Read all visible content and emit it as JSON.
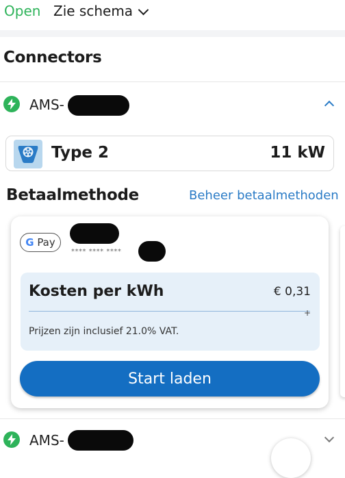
{
  "header": {
    "status": "Open",
    "schedule_link": "Zie schema"
  },
  "connectors_section": {
    "title": "Connectors"
  },
  "connectors": [
    {
      "name": "AMS-",
      "expanded": true
    },
    {
      "name": "AMS-",
      "expanded": false
    }
  ],
  "plug": {
    "type": "Type 2",
    "power": "11 kW"
  },
  "payment": {
    "title": "Betaalmethode",
    "manage_link": "Beheer betaalmethoden",
    "method": "G Pay",
    "card_mask": "**** **** ****"
  },
  "cost": {
    "label": "Kosten per kWh",
    "price": "€ 0,31",
    "expand_symbol": "+",
    "vat_note": "Prijzen zijn inclusief 21.0% VAT."
  },
  "actions": {
    "start_label": "Start laden"
  },
  "colors": {
    "open_green": "#2eb35a",
    "link_blue": "#2a7bc6",
    "button_blue": "#146ec2",
    "cost_bg": "#e6f0f9"
  }
}
